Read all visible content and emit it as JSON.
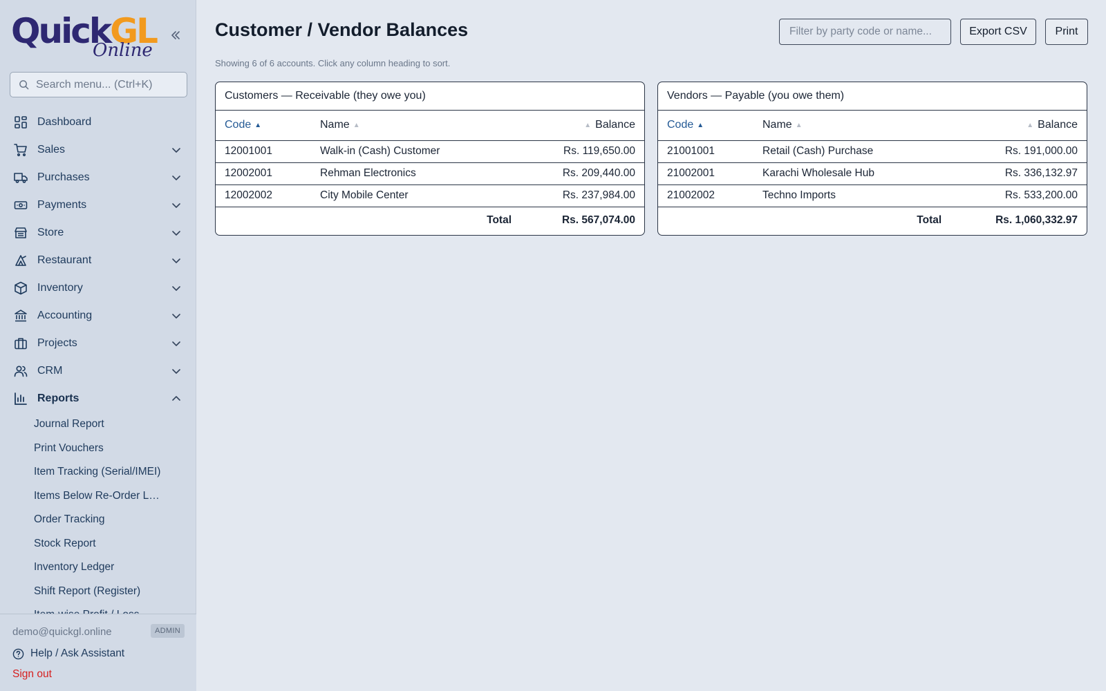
{
  "brand": {
    "logo_main_a": "Quick",
    "logo_main_b": "GL",
    "logo_sub": "Online"
  },
  "search": {
    "placeholder": "Search menu... (Ctrl+K)"
  },
  "nav": {
    "items": [
      {
        "label": "Dashboard",
        "icon": "dashboard-icon"
      },
      {
        "label": "Sales",
        "icon": "cart-icon"
      },
      {
        "label": "Purchases",
        "icon": "truck-icon"
      },
      {
        "label": "Payments",
        "icon": "banknote-icon"
      },
      {
        "label": "Store",
        "icon": "store-icon"
      },
      {
        "label": "Restaurant",
        "icon": "chef-hat-icon"
      },
      {
        "label": "Inventory",
        "icon": "box-icon"
      },
      {
        "label": "Accounting",
        "icon": "bank-icon"
      },
      {
        "label": "Projects",
        "icon": "briefcase-icon"
      },
      {
        "label": "CRM",
        "icon": "users-icon"
      },
      {
        "label": "Reports",
        "icon": "bar-chart-icon"
      }
    ],
    "reports_sub": [
      "Journal Report",
      "Print Vouchers",
      "Item Tracking (Serial/IMEI)",
      "Items Below Re-Order L…",
      "Order Tracking",
      "Stock Report",
      "Inventory Ledger",
      "Shift Report (Register)",
      "Item-wise Profit / Loss"
    ]
  },
  "footer": {
    "email": "demo@quickgl.online",
    "role": "ADMIN",
    "help": "Help / Ask Assistant",
    "signout": "Sign out"
  },
  "page": {
    "title": "Customer / Vendor Balances",
    "filter_placeholder": "Filter by party code or name...",
    "export_label": "Export CSV",
    "print_label": "Print",
    "caption": "Showing 6 of 6 accounts. Click any column heading to sort."
  },
  "columns": {
    "code": "Code",
    "name": "Name",
    "balance": "Balance",
    "total": "Total"
  },
  "customers": {
    "title": "Customers — Receivable (they owe you)",
    "rows": [
      {
        "code": "12001001",
        "name": "Walk-in (Cash) Customer",
        "balance": "Rs. 119,650.00"
      },
      {
        "code": "12002001",
        "name": "Rehman Electronics",
        "balance": "Rs. 209,440.00"
      },
      {
        "code": "12002002",
        "name": "City Mobile Center",
        "balance": "Rs. 237,984.00"
      }
    ],
    "total": "Rs. 567,074.00"
  },
  "vendors": {
    "title": "Vendors — Payable (you owe them)",
    "rows": [
      {
        "code": "21001001",
        "name": "Retail (Cash) Purchase",
        "balance": "Rs. 191,000.00"
      },
      {
        "code": "21002001",
        "name": "Karachi Wholesale Hub",
        "balance": "Rs. 336,132.97"
      },
      {
        "code": "21002002",
        "name": "Techno Imports",
        "balance": "Rs. 533,200.00"
      }
    ],
    "total": "Rs. 1,060,332.97"
  },
  "colors": {
    "brand_navy": "#2e2872",
    "brand_orange": "#f29a1e",
    "link_blue": "#245a95",
    "signout_red": "#d61f1f"
  }
}
